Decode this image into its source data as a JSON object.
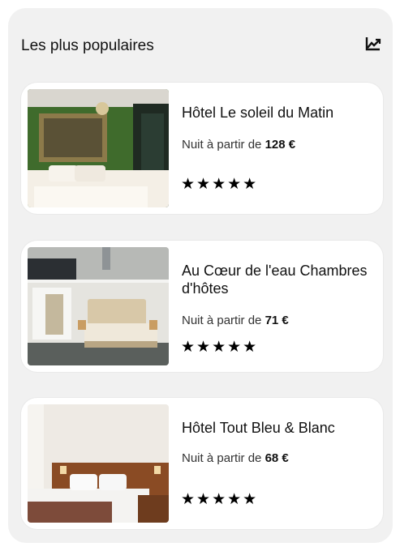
{
  "section": {
    "title": "Les plus populaires",
    "icon": "trending-chart-icon"
  },
  "hotels": [
    {
      "name": "Hôtel Le soleil du Matin",
      "price_prefix": "Nuit à partir de",
      "price": "128 €",
      "rating": 5,
      "stars": "★★★★★"
    },
    {
      "name": "Au Cœur de l'eau Chambres d'hôtes",
      "price_prefix": "Nuit à partir de",
      "price": "71 €",
      "rating": 5,
      "stars": "★★★★★"
    },
    {
      "name": "Hôtel Tout Bleu & Blanc",
      "price_prefix": "Nuit à partir de",
      "price": "68 €",
      "rating": 5,
      "stars": "★★★★★"
    }
  ]
}
